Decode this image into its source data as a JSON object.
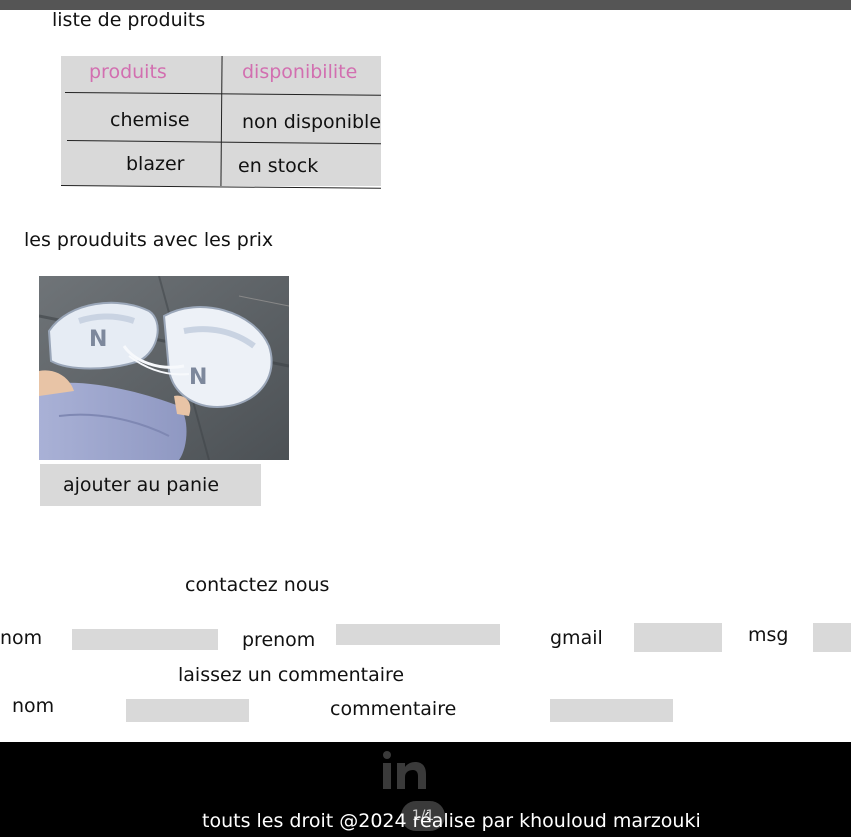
{
  "section_products": {
    "title": "liste de produits",
    "table": {
      "headers": [
        "produits",
        "disponibilite"
      ],
      "rows": [
        [
          "chemise",
          "non disponible"
        ],
        [
          "blazer",
          "en stock"
        ]
      ]
    }
  },
  "section_prices": {
    "title": "les prouduits  avec les prix",
    "image_alt": "photo de baskets",
    "add_button": "ajouter au panie"
  },
  "contact": {
    "title": "contactez nous",
    "labels": {
      "nom": "nom",
      "prenom": "prenom",
      "gmail": "gmail",
      "msg": "msg"
    }
  },
  "comments": {
    "title": "laissez un commentaire",
    "labels": {
      "nom": "nom",
      "commentaire": "commentaire"
    }
  },
  "footer": {
    "copyright": "touts les droit @2024 réalise par khouloud marzouki",
    "pager": "1/1",
    "social_icon": "linkedin-icon"
  },
  "colors": {
    "table_bg": "#d9d9d9",
    "header_text": "#d26fb0",
    "field_bg": "#d9d9d9",
    "footer_bg": "#000000"
  }
}
